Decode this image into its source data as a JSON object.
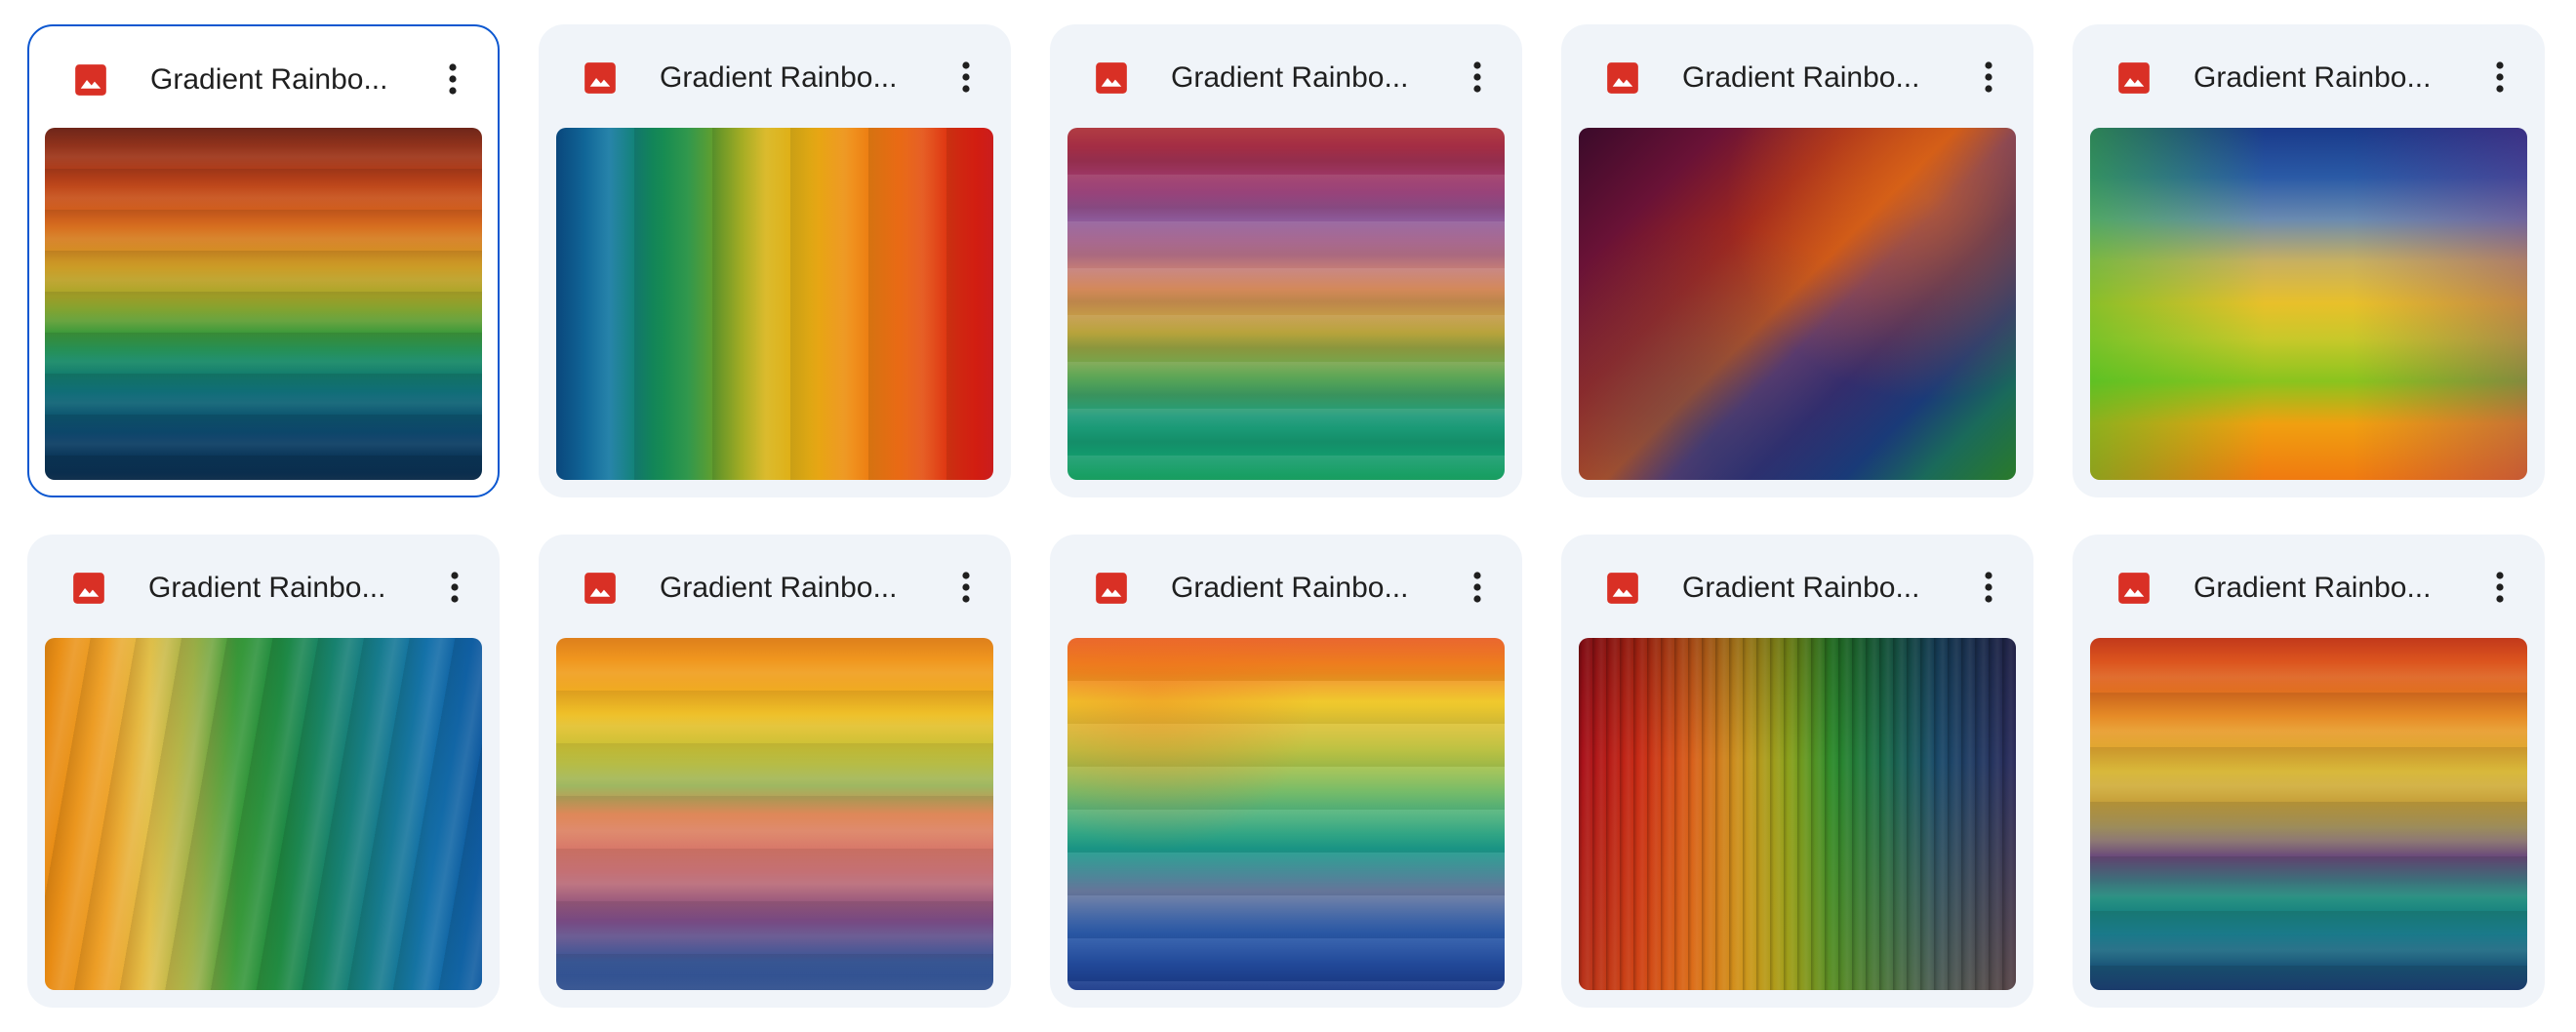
{
  "files": [
    {
      "name": "Gradient Rainbo...",
      "icon": "image-icon",
      "selected": true,
      "gradient": "linear-gradient(180deg, #7a2a1c 0%, #b8401a 14%, #d8661e 26%, #d39a26 38%, #a8a82a 48%, #3f9a3a 58%, #178a66 66%, #0f6a78 76%, #0c4168 88%, #0a2a48 100%)",
      "overlay": "repeating-linear-gradient(180deg, rgba(0,0,0,0.10) 0px, rgba(0,0,0,0) 18px, rgba(255,255,255,0.06) 30px, rgba(0,0,0,0) 42px)"
    },
    {
      "name": "Gradient Rainbo...",
      "icon": "image-icon",
      "selected": false,
      "gradient": "linear-gradient(90deg, #0b4f8a 0%, #1579a3 12%, #138a5c 22%, #1f8f3e 30%, #7aa52a 38%, #d8b51c 48%, #e6ad14 58%, #ef8a12 68%, #e86414 80%, #dc2a12 92%, #c81010 100%)",
      "overlay": "repeating-linear-gradient(90deg, rgba(0,0,0,0.10) 0px, rgba(0,0,0,0) 30px, rgba(255,255,255,0.08) 55px, rgba(0,0,0,0) 80px)"
    },
    {
      "name": "Gradient Rainbo...",
      "icon": "image-icon",
      "selected": false,
      "gradient": "linear-gradient(180deg, #a8262e 0%, #9a3a6e 16%, #8e5a9a 26%, #b8728a 36%, #d58a5a 46%, #b8a23a 58%, #5ea450 70%, #1e9a7a 82%, #129a6e 92%, #1aa062 100%)",
      "overlay": "repeating-linear-gradient(180deg, rgba(255,255,255,0.10) 0px, rgba(0,0,0,0) 20px, rgba(0,0,0,0.08) 34px, rgba(0,0,0,0) 48px)"
    },
    {
      "name": "Gradient Rainbo...",
      "icon": "image-icon",
      "selected": false,
      "gradient": "linear-gradient(135deg, #3a0a2a 0%, #6a1236 18%, #a0281e 34%, #c8541a 48%, #6a3a6a 56%, #3a2a6a 66%, #1a3a78 78%, #1a6a5a 88%, #2a7a2a 100%)",
      "overlay": "radial-gradient(circle at 80% 20%, rgba(230,110,20,0.55) 0%, rgba(0,0,0,0) 45%), radial-gradient(circle at 30% 90%, rgba(20,60,120,0.45) 0%, rgba(0,0,0,0) 50%)"
    },
    {
      "name": "Gradient Rainbo...",
      "icon": "image-icon",
      "selected": false,
      "gradient": "linear-gradient(180deg, #1a3a8a 0%, #2a5aa6 14%, #6a8ab0 26%, #c8b060 38%, #e8c02a 50%, #c8c82a 60%, #8ac41e 72%, #f0a010 84%, #f07a10 100%)",
      "overlay": "linear-gradient(90deg, rgba(60,190,40,0.55) 0%, rgba(0,0,0,0) 40%, rgba(0,0,0,0) 60%, rgba(120,30,120,0.35) 100%)"
    },
    {
      "name": "Gradient Rainbo...",
      "icon": "image-icon",
      "selected": false,
      "gradient": "linear-gradient(90deg, #e88a12 0%, #eea22a 14%, #e2c04a 24%, #9eb048 34%, #3a9a3a 44%, #1f8a42 54%, #17826e 66%, #167a92 78%, #1470aa 88%, #0f5aa0 100%)",
      "overlay": "repeating-linear-gradient(100deg, rgba(0,0,0,0.10) 0px, rgba(0,0,0,0) 18px, rgba(255,255,255,0.10) 32px, rgba(0,0,0,0) 46px)"
    },
    {
      "name": "Gradient Rainbo...",
      "icon": "image-icon",
      "selected": false,
      "gradient": "linear-gradient(180deg, #f08a1e 0%, #f0a21e 12%, #eec028 22%, #c8c23a 32%, #9ab45a 42%, #e08a5a 50%, #d8786a 60%, #b86a78 70%, #7a4a82 80%, #3a5a9a 92%, #2a4a8a 100%)",
      "overlay": "repeating-linear-gradient(180deg, rgba(0,0,0,0.08) 0px, rgba(0,0,0,0) 22px, rgba(255,255,255,0.08) 36px, rgba(0,0,0,0) 54px)"
    },
    {
      "name": "Gradient Rainbo...",
      "icon": "image-icon",
      "selected": false,
      "gradient": "linear-gradient(180deg, #e85a1e 0%, #f08a1e 10%, #f0c82a 18%, #d8c23a 26%, #a8c24a 36%, #5ab87a 48%, #1a9a8a 60%, #6a7aa0 72%, #2a5aaa 84%, #1a3a8a 100%)",
      "overlay": "radial-gradient(circle at 20% 15%, rgba(240,110,30,0.35) 0%, rgba(0,0,0,0) 35%), repeating-linear-gradient(180deg, rgba(255,255,255,0.08) 0px, rgba(0,0,0,0) 26px, rgba(0,0,0,0.06) 44px)"
    },
    {
      "name": "Gradient Rainbo...",
      "icon": "image-icon",
      "selected": false,
      "gradient": "linear-gradient(90deg, #a8101a 0%, #c82a14 14%, #d8601a 26%, #c8981e 38%, #8aa01a 48%, #2a8a2a 58%, #1a6a4a 70%, #1a4a6a 82%, #2a2a5a 100%)",
      "overlay": "repeating-linear-gradient(90deg, rgba(0,0,0,0.22) 0px, rgba(0,0,0,0) 4px, rgba(255,255,255,0.06) 9px, rgba(0,0,0,0) 14px), linear-gradient(180deg, rgba(0,0,0,0.25) 0%, rgba(0,0,0,0) 35%, rgba(230,150,20,0.25) 100%)"
    },
    {
      "name": "Gradient Rainbo...",
      "icon": "image-icon",
      "selected": false,
      "gradient": "linear-gradient(180deg, #d8401e 0%, #e06a1e 14%, #e89a2a 26%, #d8b83a 38%, #c8a23a 46%, #9a8a5a 54%, #6a4a7a 62%, #1a8a7a 74%, #1a7a8a 84%, #1a3a6a 100%)",
      "overlay": "repeating-linear-gradient(180deg, rgba(0,0,0,0.10) 0px, rgba(0,0,0,0) 24px, rgba(255,255,255,0.08) 40px, rgba(0,0,0,0) 56px)"
    }
  ]
}
